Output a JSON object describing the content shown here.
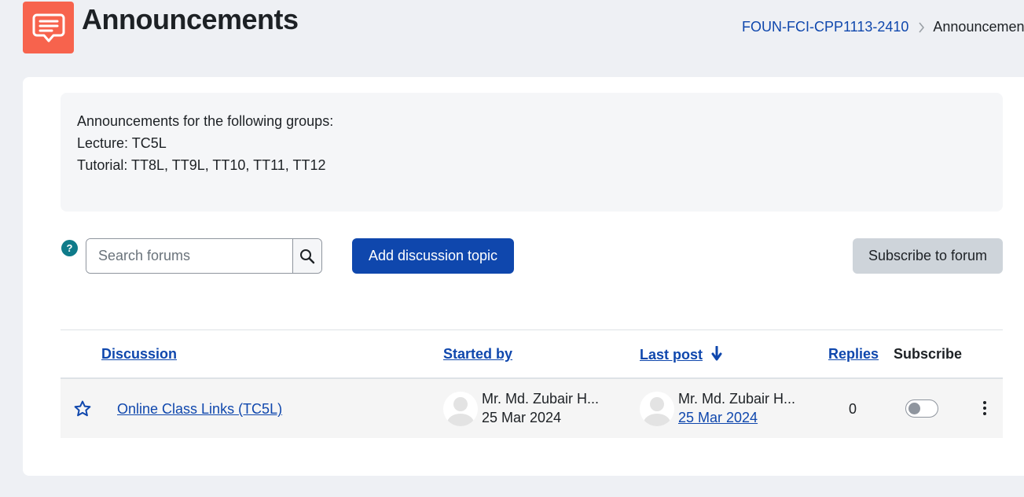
{
  "header": {
    "title": "Announcements",
    "icon": "announcement-icon",
    "icon_color": "#f7634d"
  },
  "breadcrumb": {
    "course": "FOUN-FCI-CPP1113-2410",
    "current": "Announcements"
  },
  "intro": {
    "lines": [
      "Announcements for the following groups:",
      "Lecture: TC5L",
      "Tutorial: TT8L, TT9L, TT10, TT11, TT12"
    ]
  },
  "toolbar": {
    "help_label": "?",
    "search_placeholder": "Search forums",
    "add_label": "Add discussion topic",
    "subscribe_label": "Subscribe to forum"
  },
  "table": {
    "headers": {
      "discussion": "Discussion",
      "started_by": "Started by",
      "last_post": "Last post",
      "replies": "Replies",
      "subscribe": "Subscribe"
    },
    "rows": [
      {
        "title": "Online Class Links (TC5L)",
        "started_by_name": "Mr. Md. Zubair H...",
        "started_date": "25 Mar 2024",
        "last_post_name": "Mr. Md. Zubair H...",
        "last_post_date": "25 Mar 2024",
        "replies": "0",
        "subscribed": false,
        "starred": false
      }
    ]
  },
  "colors": {
    "primary": "#0f47ad",
    "secondary_button": "#ced4da",
    "help": "#0f7b8a"
  }
}
